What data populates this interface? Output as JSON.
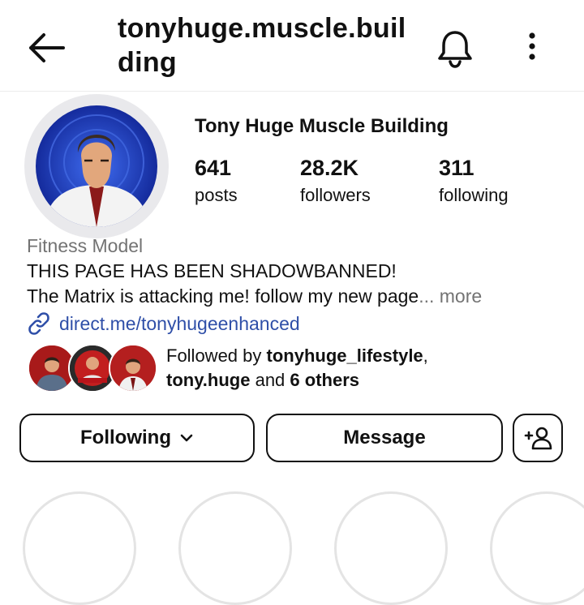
{
  "header": {
    "title": "tonyhuge.muscle.building",
    "back_icon": "back-arrow-icon",
    "bell_icon": "bell-icon",
    "menu_icon": "more-vertical-icon"
  },
  "profile": {
    "display_name": "Tony Huge Muscle Building",
    "stats": {
      "posts": {
        "value": "641",
        "label": "posts"
      },
      "followers": {
        "value": "28.2K",
        "label": "followers"
      },
      "following": {
        "value": "311",
        "label": "following"
      }
    },
    "category": "Fitness Model",
    "bio_line1": "THIS PAGE HAS BEEN SHADOWBANNED!",
    "bio_line2": "The Matrix is attacking me! follow my new page",
    "bio_ellipsis": "...",
    "more_label": "more",
    "link": "direct.me/tonyhugeenhanced",
    "link_icon": "link-icon"
  },
  "mutual": {
    "prefix": "Followed by ",
    "user1": "tonyhuge_lifestyle",
    "separator": ",",
    "user2": "tony.huge",
    "and_text": " and ",
    "others": "6 others"
  },
  "buttons": {
    "following": "Following",
    "following_icon": "chevron-down-icon",
    "message": "Message",
    "add_icon": "add-person-icon"
  },
  "colors": {
    "link": "#2f4fa8",
    "muted": "#737373",
    "avatar_bg": "#1f3fbf"
  }
}
